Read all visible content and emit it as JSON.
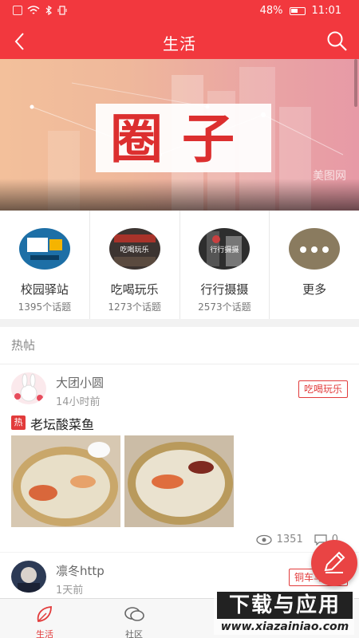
{
  "status_bar": {
    "battery": "48%",
    "time": "11:01"
  },
  "header": {
    "title": "生活"
  },
  "banner": {
    "title": "圈子",
    "watermark_text": "美图网"
  },
  "categories": [
    {
      "name": "校园驿站",
      "count": "1395个话题",
      "icon": "campus-image-icon"
    },
    {
      "name": "吃喝玩乐",
      "count": "1273个话题",
      "overlay": "吃喝玩乐",
      "icon": "food-image-icon"
    },
    {
      "name": "行行摄摄",
      "count": "2573个话题",
      "overlay": "行行摄摄",
      "icon": "photo-image-icon"
    },
    {
      "name": "更多",
      "count": "",
      "icon": "more-dots-icon"
    }
  ],
  "section": {
    "title": "热帖"
  },
  "posts": [
    {
      "author": "大团小圆",
      "time": "14小时前",
      "tag": "吃喝玩乐",
      "hot_badge": "热",
      "title": "老坛酸菜鱼",
      "views": "1351",
      "comments": "0"
    },
    {
      "author": "凛冬http",
      "time": "1天前",
      "tag": "铜车马社区"
    }
  ],
  "bottom_nav": [
    {
      "label": "生活",
      "active": true
    },
    {
      "label": "社区",
      "active": false
    }
  ],
  "watermark": {
    "top": "下载与应用",
    "bottom": "www.xiazainiao.com"
  },
  "colors": {
    "primary": "#f2383e",
    "accent": "#e23b3b"
  }
}
